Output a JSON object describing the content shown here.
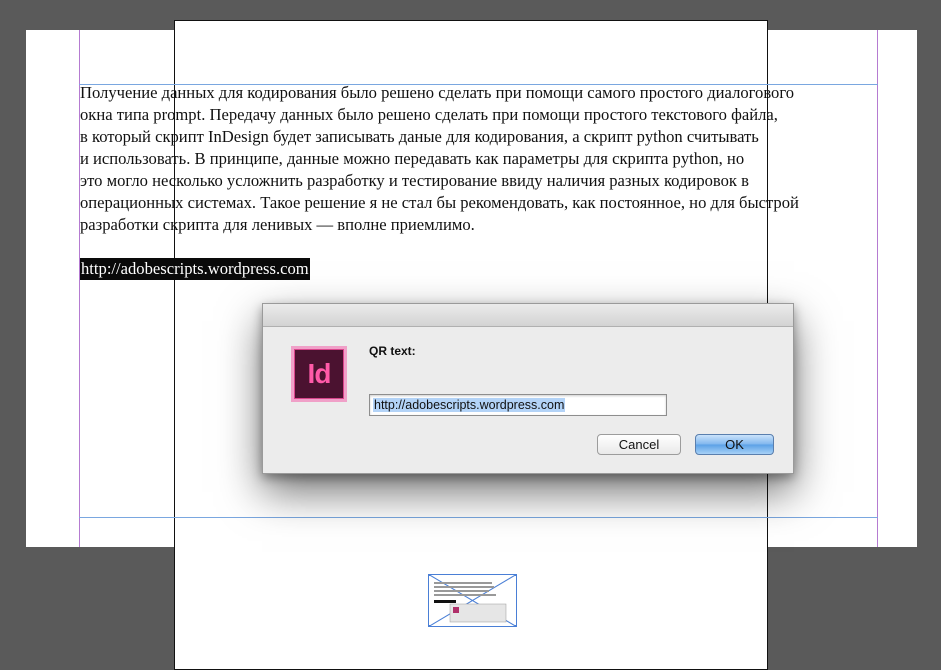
{
  "document": {
    "paragraph_lines": [
      "Получение данных для кодирования было решено сделать при помощи самого простого диалогового",
      "окна типа prompt. Передачу данных было решено сделать при помощи простого текстового файла,",
      "в который скрипт InDesign будет записывать даные для кодирования, а скрипт python считывать",
      "и использовать. В принципе, данные можно передавать как параметры для скрипта python, но",
      "это могло несколько усложнить разработку и тестирование ввиду наличия разных кодировок в",
      "операционных системах. Такое решение я не стал бы рекомендовать, как постоянное, но для быстрой",
      "разработки скрипта для ленивых — вполне приемлимо."
    ],
    "selected_link": "http://adobescripts.wordpress.com"
  },
  "dialog": {
    "app_icon": "indesign-app-icon",
    "app_icon_text": "Id",
    "label": "QR text:",
    "input_value": "http://adobescripts.wordpress.com",
    "cancel_label": "Cancel",
    "ok_label": "OK"
  },
  "colors": {
    "pasteboard": "#5a5a5a",
    "margin_guide": "#b57bd1",
    "column_guide": "#7aa7e0",
    "icon_background": "#4b1230",
    "icon_accent": "#ff5aa8",
    "selection_highlight": "#b3d3f7"
  }
}
